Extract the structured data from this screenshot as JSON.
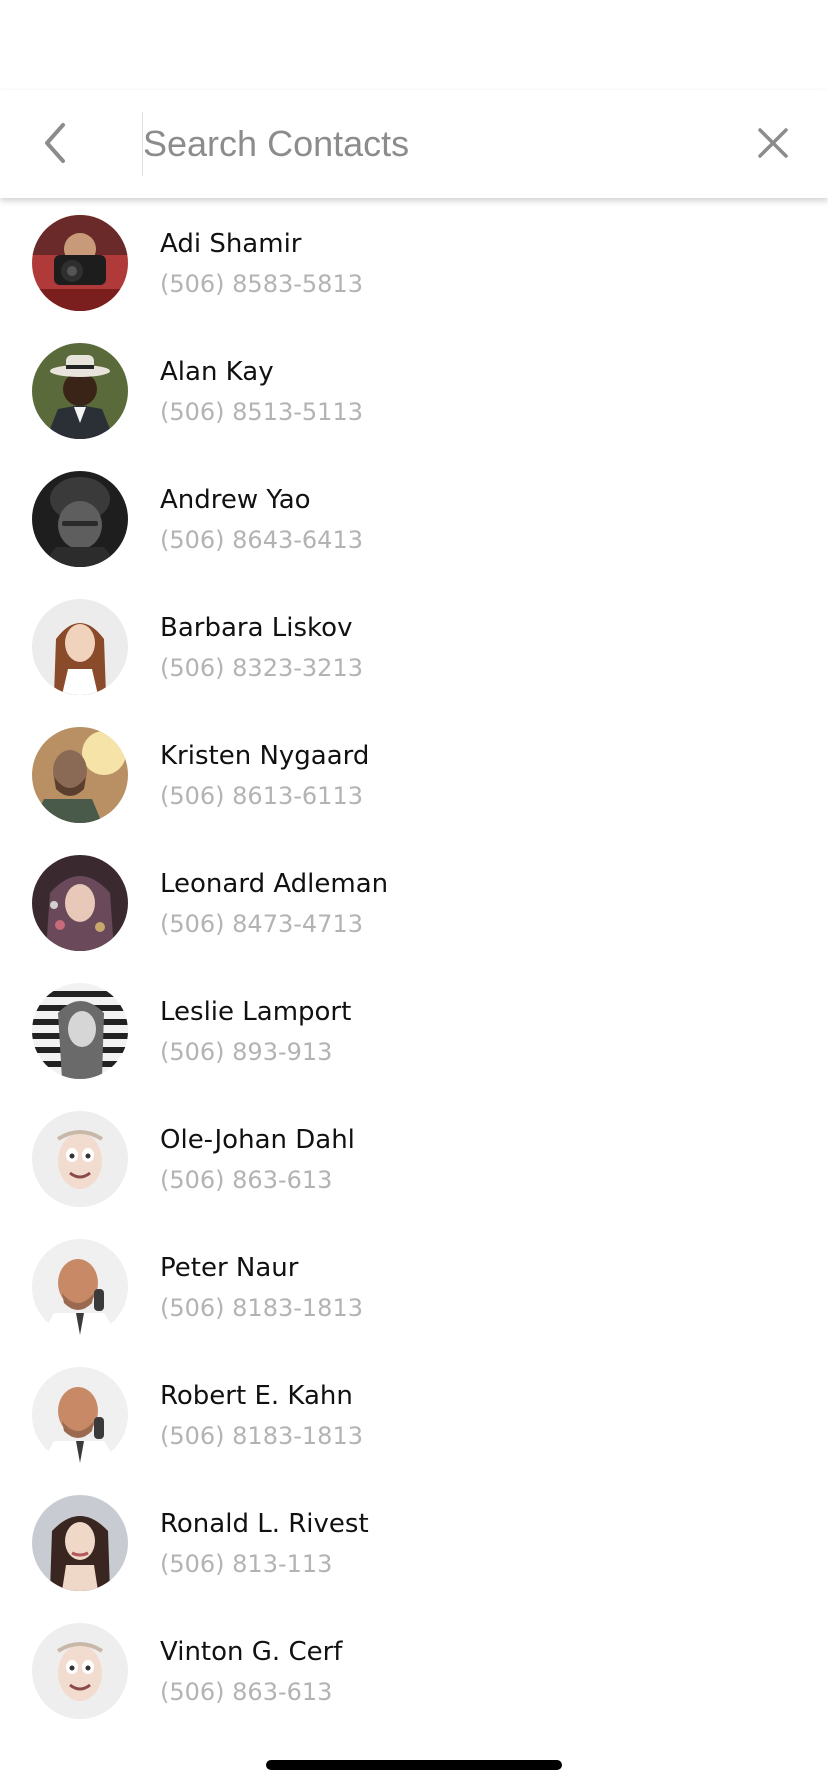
{
  "search": {
    "placeholder": "Search Contacts",
    "value": ""
  },
  "icons": {
    "back": "chevron-left-icon",
    "clear": "close-icon"
  },
  "colors": {
    "name_text": "#111111",
    "phone_text": "#b3b3b3",
    "placeholder_text": "#8c8c8c",
    "icon": "#8c8c8c",
    "home_indicator": "#000000"
  },
  "contacts": [
    {
      "name": "Adi Shamir",
      "phone": "(506) 8583-5813"
    },
    {
      "name": "Alan Kay",
      "phone": "(506) 8513-5113"
    },
    {
      "name": "Andrew Yao",
      "phone": "(506) 8643-6413"
    },
    {
      "name": "Barbara Liskov",
      "phone": "(506) 8323-3213"
    },
    {
      "name": "Kristen Nygaard",
      "phone": "(506) 8613-6113"
    },
    {
      "name": "Leonard Adleman",
      "phone": "(506) 8473-4713"
    },
    {
      "name": "Leslie Lamport",
      "phone": "(506) 893-913"
    },
    {
      "name": "Ole-Johan Dahl",
      "phone": "(506) 863-613"
    },
    {
      "name": "Peter Naur",
      "phone": "(506) 8183-1813"
    },
    {
      "name": "Robert E. Kahn",
      "phone": "(506) 8183-1813"
    },
    {
      "name": "Ronald L. Rivest",
      "phone": "(506) 813-113"
    },
    {
      "name": "Vinton G. Cerf",
      "phone": "(506) 863-613"
    }
  ]
}
